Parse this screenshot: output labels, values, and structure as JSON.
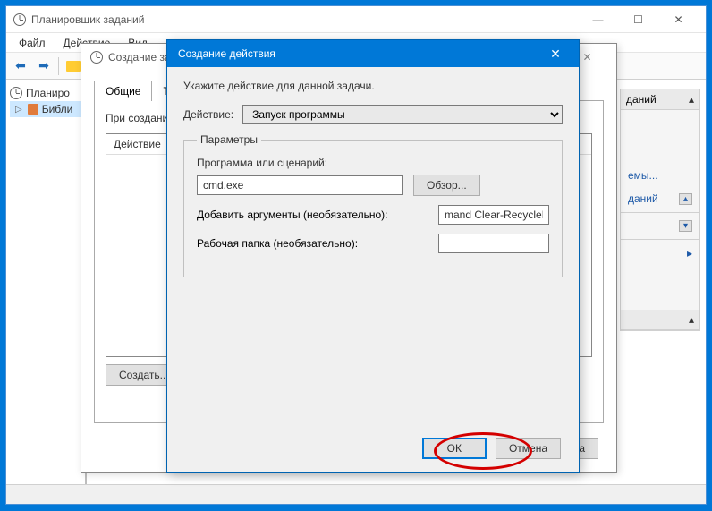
{
  "main": {
    "title": "Планировщик заданий",
    "menu": {
      "file": "Файл",
      "action": "Действие",
      "view": "Вид"
    },
    "tree": {
      "root": "Планиро",
      "lib": "Библи"
    },
    "actions_pane": {
      "header": "даний",
      "item1": "емы...",
      "item2": "даний"
    }
  },
  "second": {
    "title": "Создание за",
    "tabs": {
      "general": "Общие",
      "triggers": "Триг"
    },
    "tab_text": "При создани",
    "list_header": "Действие",
    "create_btn": "Создать...",
    "cancel_btn": "Отмена"
  },
  "dialog": {
    "title": "Создание действия",
    "instruction": "Укажите действие для данной задачи.",
    "action_label": "Действие:",
    "action_value": "Запуск программы",
    "params_legend": "Параметры",
    "program_label": "Программа или сценарий:",
    "program_value": "cmd.exe",
    "browse_btn": "Обзор...",
    "args_label": "Добавить аргументы (необязательно):",
    "args_value": "mand Clear-RecycleBin\"",
    "folder_label": "Рабочая папка (необязательно):",
    "folder_value": "",
    "ok_btn": "ОК",
    "cancel_btn": "Отмена"
  }
}
